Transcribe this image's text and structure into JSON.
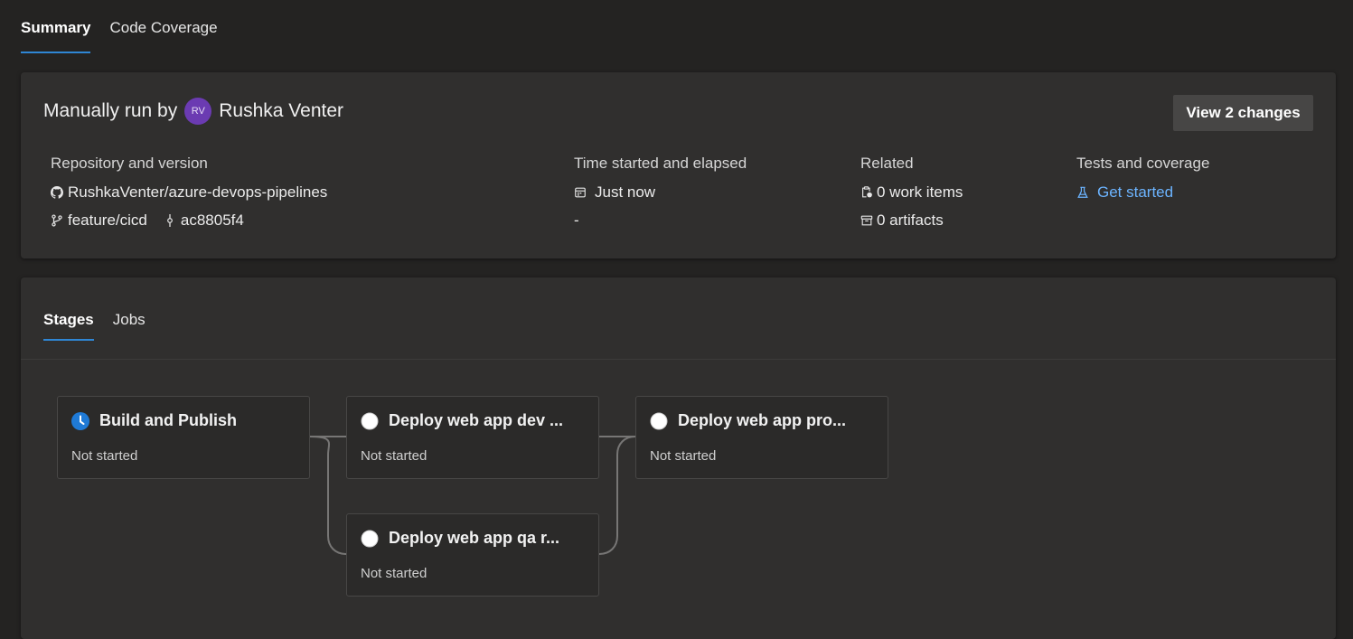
{
  "tabs": {
    "summary": "Summary",
    "code_coverage": "Code Coverage"
  },
  "summary": {
    "run_prefix": "Manually run by",
    "avatar_initials": "RV",
    "user_name": "Rushka Venter",
    "view_changes": "View 2 changes",
    "repository": {
      "heading": "Repository and version",
      "repo": "RushkaVenter/azure-devops-pipelines",
      "branch": "feature/cicd",
      "commit": "ac8805f4"
    },
    "time": {
      "heading": "Time started and elapsed",
      "started": "Just now",
      "elapsed": "-"
    },
    "related": {
      "heading": "Related",
      "work_items": "0 work items",
      "artifacts": "0 artifacts"
    },
    "tests": {
      "heading": "Tests and coverage",
      "link": "Get started"
    }
  },
  "stage_tabs": {
    "stages": "Stages",
    "jobs": "Jobs"
  },
  "stages": [
    {
      "title": "Build and Publish",
      "status": "Not started",
      "icon": "clock-icon"
    },
    {
      "title": "Deploy web app dev ...",
      "status": "Not started",
      "icon": "circle-icon"
    },
    {
      "title": "Deploy web app qa r...",
      "status": "Not started",
      "icon": "circle-icon"
    },
    {
      "title": "Deploy web app pro...",
      "status": "Not started",
      "icon": "circle-icon"
    }
  ],
  "colors": {
    "accent": "#2f86d4",
    "link": "#6cb4ff",
    "avatar": "#6b3bb2",
    "clock": "#1f7ad6"
  }
}
